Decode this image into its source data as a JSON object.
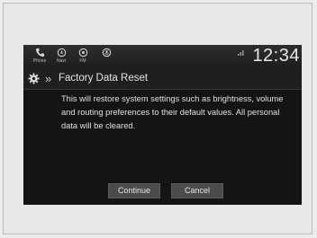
{
  "status_bar": {
    "items": [
      {
        "label": "Phone",
        "icon": "phone-icon"
      },
      {
        "label": "Navi",
        "icon": "navigation-icon"
      },
      {
        "label": "FM",
        "icon": "radio-icon"
      },
      {
        "label": "",
        "icon": "microphone-icon"
      }
    ],
    "clock": "12:34"
  },
  "title_bar": {
    "icon": "gear-icon",
    "breadcrumb_icon": "»",
    "title": "Factory Data Reset"
  },
  "message": "This will restore system settings such as brightness, volume and routing preferences to their default values. All personal data will be cleared.",
  "buttons": {
    "continue_label": "Continue",
    "cancel_label": "Cancel"
  }
}
